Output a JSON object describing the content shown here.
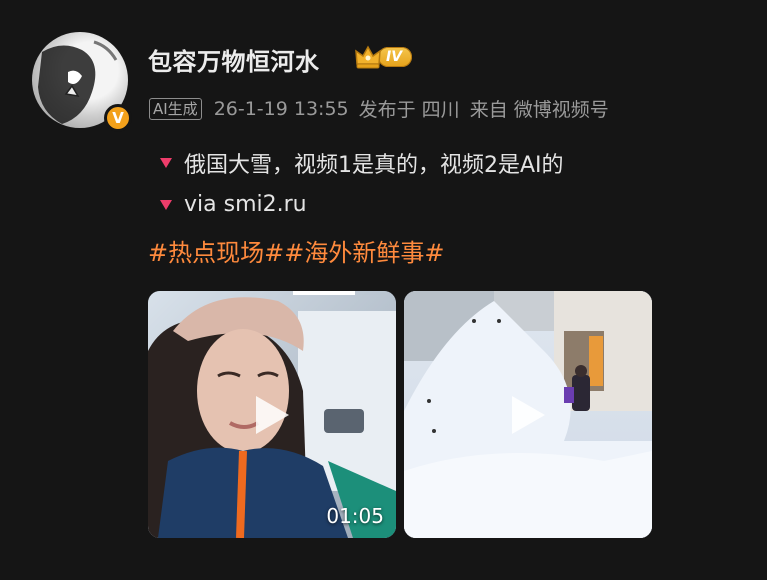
{
  "post": {
    "username": "包容万物恒河水",
    "level_badge": "IV",
    "ai_tag": "AI生成",
    "timestamp": "26-1-19 13:55",
    "published_in": "发布于 四川",
    "source": "来自 微博视频号",
    "lines": [
      "俄国大雪，视频1是真的，视频2是AI的",
      "via smi2.ru"
    ],
    "hashtags": [
      "#热点现场#",
      "#海外新鲜事#"
    ],
    "videos": [
      {
        "duration": "01:05"
      },
      {
        "duration": ""
      }
    ]
  },
  "colors": {
    "background": "#151515",
    "hashtag": "#ff8a3d",
    "bullet": "#ee3d6b",
    "verified": "#f3a11b"
  },
  "icons": [
    "verified-v-icon",
    "crown-icon",
    "play-icon"
  ]
}
